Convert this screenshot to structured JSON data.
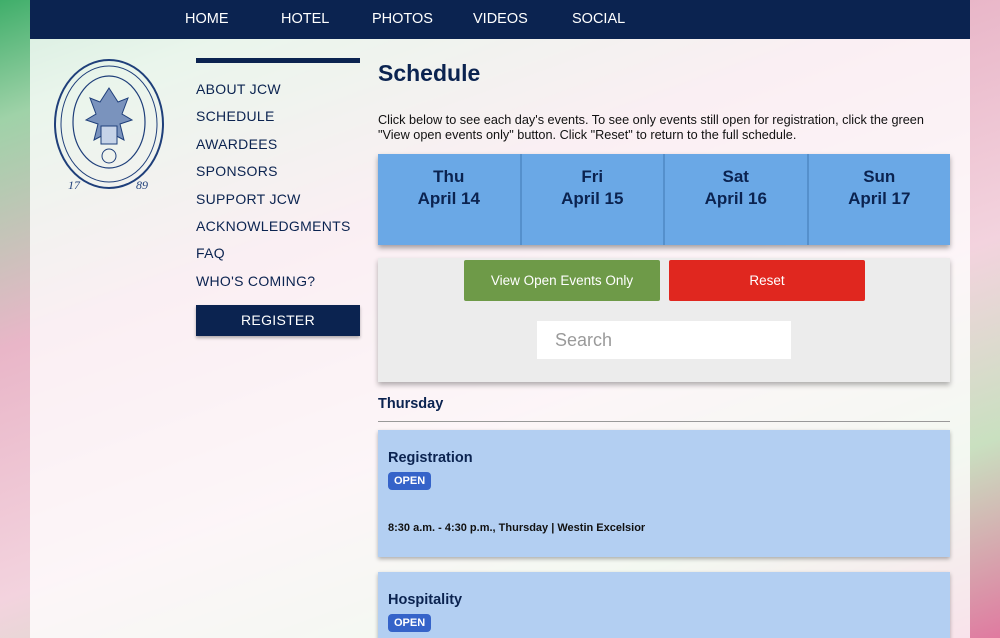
{
  "topnav": {
    "items": [
      {
        "label": "HOME"
      },
      {
        "label": "HOTEL"
      },
      {
        "label": "PHOTOS"
      },
      {
        "label": "VIDEOS"
      },
      {
        "label": "SOCIAL"
      }
    ]
  },
  "seal": {
    "year_left": "17",
    "year_right": "89"
  },
  "sidebar": {
    "items": [
      {
        "label": "ABOUT JCW"
      },
      {
        "label": "SCHEDULE"
      },
      {
        "label": "AWARDEES"
      },
      {
        "label": "SPONSORS"
      },
      {
        "label": "SUPPORT JCW"
      },
      {
        "label": "ACKNOWLEDGMENTS"
      },
      {
        "label": "FAQ"
      },
      {
        "label": "WHO'S COMING?"
      }
    ],
    "register_label": "REGISTER"
  },
  "main": {
    "title": "Schedule",
    "intro": "Click below to see each day's events. To see only events still open for registration, click the green \"View open events only\" button. Click \"Reset\" to return to the full schedule.",
    "days": [
      {
        "dow": "Thu",
        "date": "April 14"
      },
      {
        "dow": "Fri",
        "date": "April 15"
      },
      {
        "dow": "Sat",
        "date": "April 16"
      },
      {
        "dow": "Sun",
        "date": "April 17"
      }
    ],
    "open_button": "View Open Events Only",
    "reset_button": "Reset",
    "search_placeholder": "Search",
    "day_heading": "Thursday",
    "events": [
      {
        "title": "Registration",
        "status": "OPEN",
        "meta": "8:30 a.m. - 4:30 p.m., Thursday | Westin Excelsior"
      },
      {
        "title": "Hospitality",
        "status": "OPEN",
        "meta": ""
      }
    ]
  },
  "colors": {
    "navy": "#0b2350",
    "day_tabs": "#6aa8e6",
    "open_green": "#6e9a48",
    "reset_red": "#e0271f",
    "event_bg": "#b3cff2",
    "badge_blue": "#3563c9"
  }
}
